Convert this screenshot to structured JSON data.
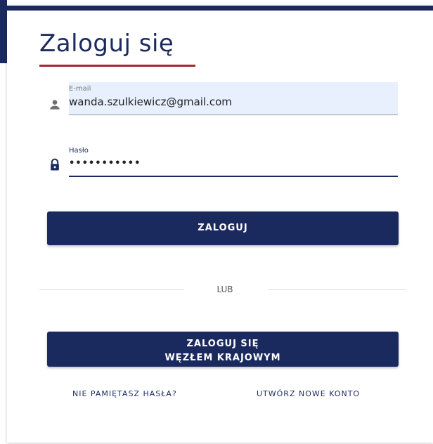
{
  "colors": {
    "primary": "#1b2a5e",
    "accent_underline": "#a3282b",
    "autofill_bg": "#e8f0fe"
  },
  "login": {
    "title": "Zaloguj się",
    "email": {
      "label": "E-mail",
      "value": "wanda.szulkiewicz@gmail.com",
      "icon": "person-icon"
    },
    "password": {
      "label": "Hasło",
      "value": "•••••••••••",
      "icon": "lock-icon"
    },
    "submit_label": "ZALOGUJ",
    "divider_label": "LUB",
    "national_node_line1": "ZALOGUJ SIĘ",
    "national_node_line2": "WĘZŁEM KRAJOWYM",
    "forgot_password_label": "NIE PAMIĘTASZ HASŁA?",
    "register_label": "UTWÓRZ NOWE KONTO"
  }
}
